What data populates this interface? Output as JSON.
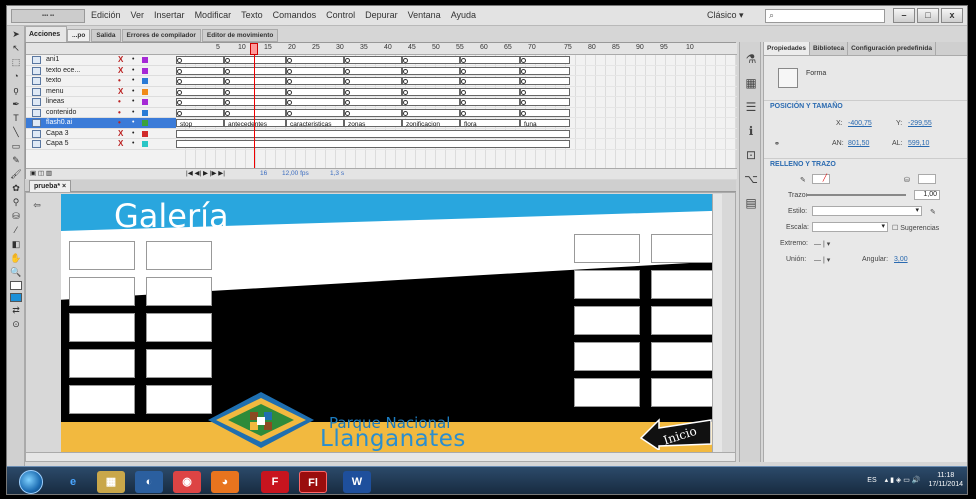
{
  "menubar": {
    "items": [
      "Edición",
      "Ver",
      "Insertar",
      "Modificar",
      "Texto",
      "Comandos",
      "Control",
      "Depurar",
      "Ventana",
      "Ayuda"
    ],
    "workspace": "Clásico ▾",
    "search_placeholder": "",
    "minimize": "–",
    "maximize": "□",
    "close": "x"
  },
  "actions_tab": "Acciones",
  "timeline_tabs": [
    "...po",
    "Salida",
    "Errores de compilador",
    "Editor de movimiento"
  ],
  "timeline": {
    "ruler": [
      "5",
      "10",
      "15",
      "20",
      "25",
      "30",
      "35",
      "40",
      "45",
      "50",
      "55",
      "60",
      "65",
      "70",
      "75",
      "80",
      "85",
      "90",
      "95",
      "10"
    ],
    "layers": [
      {
        "name": "ani1",
        "eye": "X",
        "color": "#a62ad6",
        "selected": false
      },
      {
        "name": "texto ece...",
        "eye": "X",
        "color": "#a62ad6",
        "selected": false
      },
      {
        "name": "texto",
        "eye": "•",
        "color": "#2a7bd6",
        "selected": false
      },
      {
        "name": "menu",
        "eye": "X",
        "color": "#f08a1a",
        "selected": false
      },
      {
        "name": "lineas",
        "eye": "•",
        "color": "#a62ad6",
        "selected": false
      },
      {
        "name": "contenido",
        "eye": "•",
        "color": "#2a7bd6",
        "selected": false
      },
      {
        "name": "flash0.ai",
        "eye": "•",
        "color": "#3aa23a",
        "selected": true
      },
      {
        "name": "Capa 3",
        "eye": "X",
        "color": "#d02a2a",
        "selected": false
      },
      {
        "name": "Capa 5",
        "eye": "X",
        "color": "#2ac6c6",
        "selected": false
      }
    ],
    "frame_labels": [
      "stop",
      "antecedentes",
      "caracteristicas",
      "zonas",
      "zonificacion",
      "flora",
      "funa"
    ],
    "footer": {
      "frame": "16",
      "fps": "12,00 fps",
      "time": "1,3 s"
    }
  },
  "document_tab": "prueba* ×",
  "stage": {
    "title": "Galería",
    "park_line1": "Parque Nacional",
    "park_line2": "Llanganates",
    "inicio": "Inicio",
    "colors": {
      "blue": "#29a6de",
      "gold": "#f2b93f",
      "green": "#2e8b3a",
      "brown": "#8b4a22"
    }
  },
  "props": {
    "tabs": [
      "Propiedades",
      "Biblioteca",
      "Configuración predefinida"
    ],
    "shape_name": "Forma",
    "section_pos": "POSICIÓN Y TAMAÑO",
    "x_label": "X:",
    "x_value": "-400,75",
    "y_label": "Y:",
    "y_value": "-299,55",
    "w_label": "AN:",
    "w_value": "801,50",
    "h_label": "AL:",
    "h_value": "599,10",
    "section_fill": "RELLENO Y TRAZO",
    "trazo_label": "Trazo:",
    "trazo_value": "1,00",
    "estilo_label": "Estilo:",
    "escala_label": "Escala:",
    "sugerencias": "Sugerencias",
    "extremo_label": "Extremo:",
    "extremo_value": "— | ▾",
    "union_label": "Unión:",
    "union_value": "— | ▾",
    "angular_label": "Angular:",
    "angular_value": "3,00"
  },
  "taskbar": {
    "language": "ES",
    "time": "11:18",
    "date": "17/11/2014",
    "apps": [
      "e",
      "▦",
      "◐",
      "◉",
      "◕",
      "F",
      "Fl",
      "W"
    ]
  }
}
